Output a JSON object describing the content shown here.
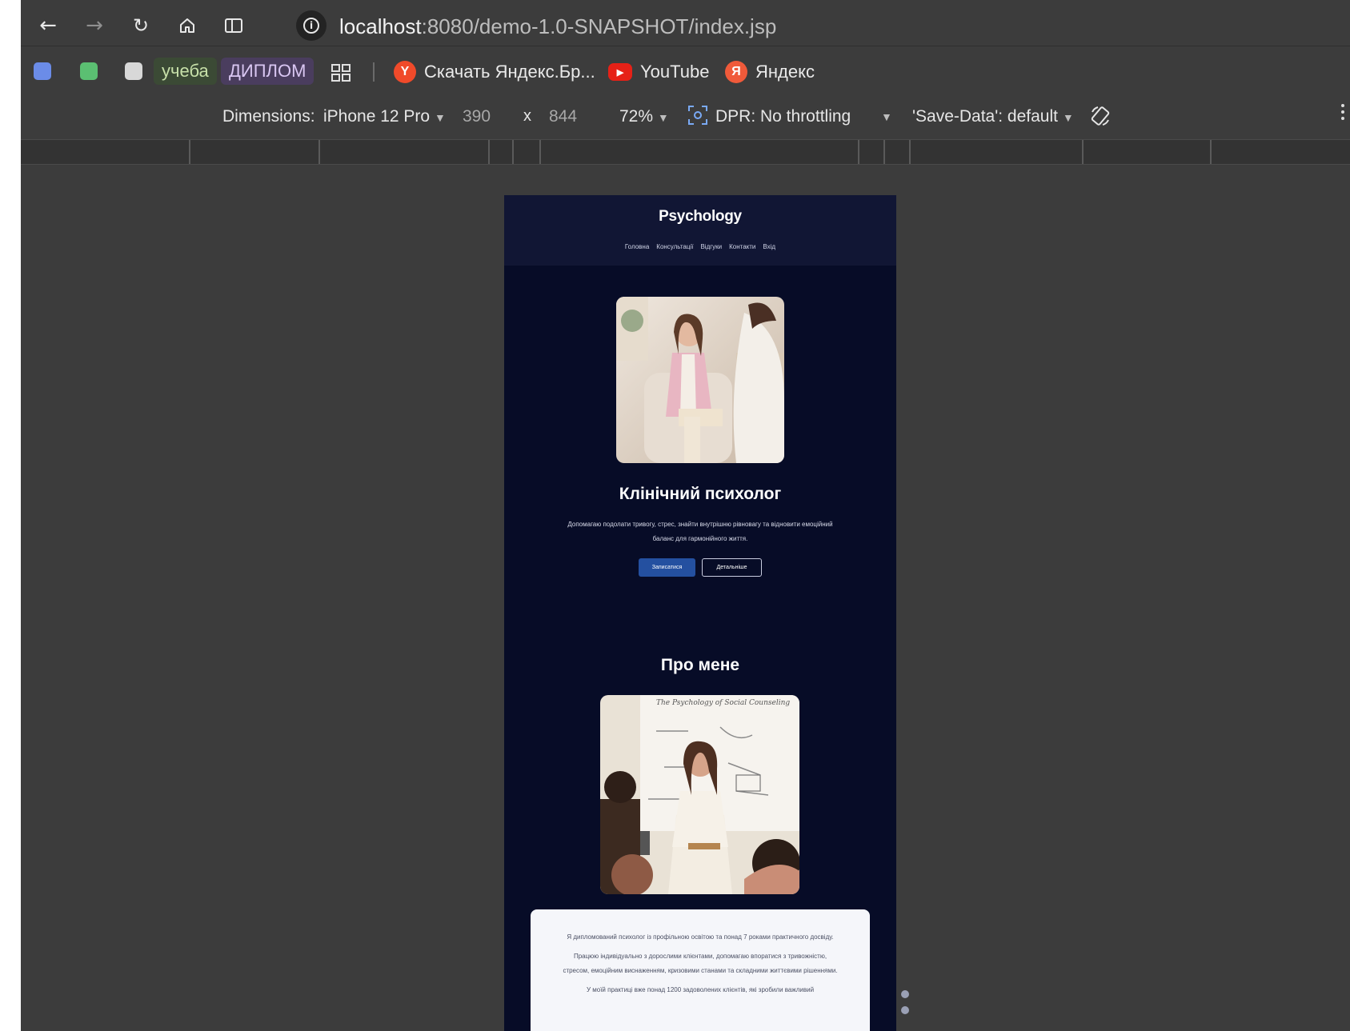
{
  "browser": {
    "url_host": "localhost",
    "url_path": ":8080/demo-1.0-SNAPSHOT/index.jsp",
    "nav_icons": [
      "back-arrow-icon",
      "forward-arrow-icon",
      "reload-icon",
      "home-icon",
      "split-view-icon",
      "site-info-icon"
    ]
  },
  "bookmarks": [
    {
      "label": "учеба"
    },
    {
      "label": "ДИПЛОМ"
    },
    {
      "label": "Скачать Яндекс.Бр..."
    },
    {
      "label": "YouTube"
    },
    {
      "label": "Яндекс"
    }
  ],
  "device_toolbar": {
    "dimensions_label": "Dimensions:",
    "device": "iPhone 12 Pro",
    "width": "390",
    "times": "x",
    "height": "844",
    "zoom": "72%",
    "dpr_label": "DPR:",
    "throttling": "No throttling",
    "save_data": "'Save-Data': default"
  },
  "site": {
    "logo": "Psychology",
    "nav": [
      "Головна",
      "Консультації",
      "Відгуки",
      "Контакти",
      "Вхід"
    ],
    "hero_title": "Клінічний психолог",
    "hero_desc": "Допомагаю подолати тривогу, стрес, знайти внутрішню рівновагу та відновити емоційний баланс для гармонійного життя.",
    "btn_signup": "Записатися",
    "btn_more": "Детальніше",
    "about_title": "Про мене",
    "about_board_text": "The Psychology of Social Counseling",
    "about_p1": "Я дипломований психолог із профільною освітою та понад 7 роками практичного досвіду.",
    "about_p2": "Працюю індивідуально з дорослими клієнтами, допомагаю впоратися з тривожністю, стресом, емоційним виснаженням, кризовими станами та складними життєвими рішеннями.",
    "about_p3": "У моїй практиці вже понад 1200 задоволених клієнтів, які зробили важливий"
  },
  "colors": {
    "chrome_bg": "#3c3c3c",
    "site_bg": "#070c27",
    "site_header": "#111634",
    "primary_button": "#2450a0",
    "card_bg": "#f5f6fa"
  }
}
